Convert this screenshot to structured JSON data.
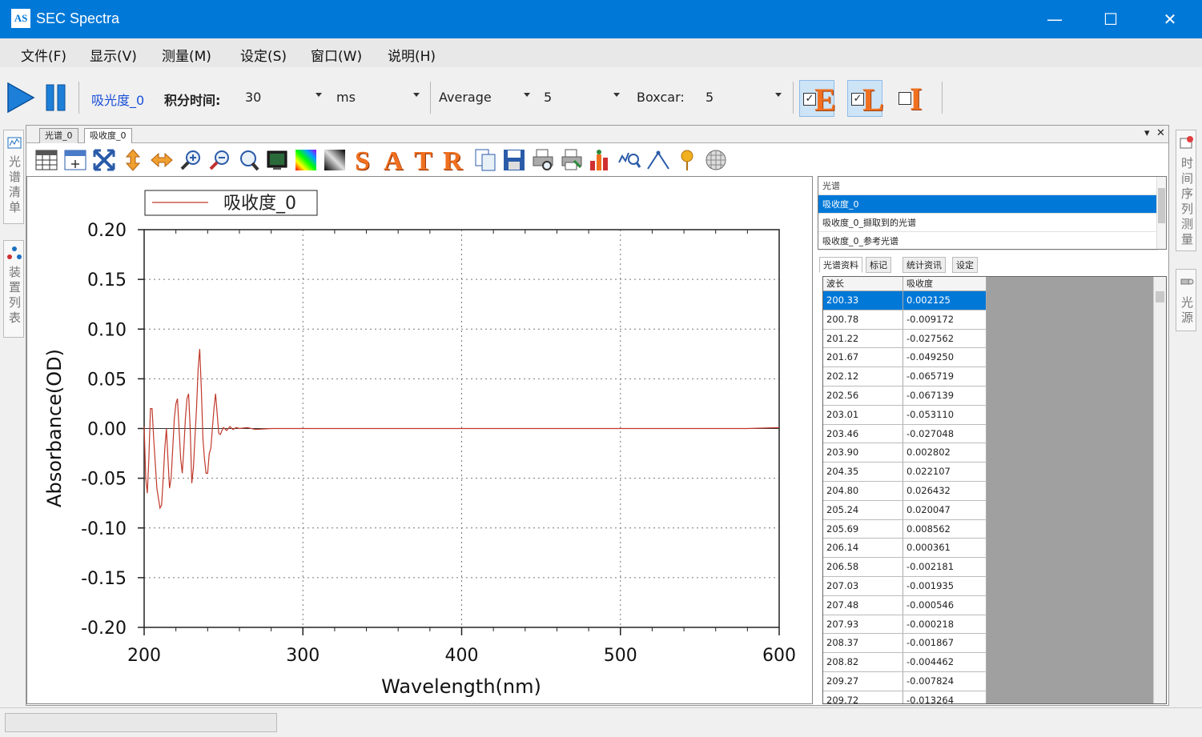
{
  "window": {
    "app_icon_text": "AS",
    "title": "SEC Spectra",
    "minimize": "—",
    "maximize": "☐",
    "close": "✕"
  },
  "menu": [
    "文件(F)",
    "显示(V)",
    "测量(M)",
    "设定(S)",
    "窗口(W)",
    "说明(H)"
  ],
  "toolbar": {
    "spectrum_name": "吸光度_0",
    "integration_label": "积分时间:",
    "integration_value": "30",
    "integration_unit": "ms",
    "average_label": "Average",
    "average_value": "5",
    "boxcar_label": "Boxcar:",
    "boxcar_value": "5",
    "eli": [
      {
        "letter": "E",
        "checked": true
      },
      {
        "letter": "L",
        "checked": true
      },
      {
        "letter": "I",
        "checked": false
      }
    ]
  },
  "left_dock": {
    "tab1": "光谱清单",
    "tab2": "装置列表"
  },
  "right_dock": {
    "tab1": "时间序列测量",
    "tab2": "光源"
  },
  "doc_tabs": {
    "tab1": "光谱_0",
    "tab2": "吸收度_0",
    "dropdown": "▾",
    "close": "✕"
  },
  "icon_letters": [
    "S",
    "A",
    "T",
    "R"
  ],
  "spectrum_list": {
    "header": "光谱",
    "items": [
      "吸收度_0",
      "吸收度_0_撷取到的光谱",
      "吸收度_0_参考光谱"
    ],
    "selected": 0
  },
  "sub_tabs": [
    "光谱资料",
    "标记",
    "统计资讯",
    "设定"
  ],
  "data_grid": {
    "columns": [
      "波长",
      "吸收度"
    ],
    "rows": [
      [
        "200.33",
        "0.002125"
      ],
      [
        "200.78",
        "-0.009172"
      ],
      [
        "201.22",
        "-0.027562"
      ],
      [
        "201.67",
        "-0.049250"
      ],
      [
        "202.12",
        "-0.065719"
      ],
      [
        "202.56",
        "-0.067139"
      ],
      [
        "203.01",
        "-0.053110"
      ],
      [
        "203.46",
        "-0.027048"
      ],
      [
        "203.90",
        "0.002802"
      ],
      [
        "204.35",
        "0.022107"
      ],
      [
        "204.80",
        "0.026432"
      ],
      [
        "205.24",
        "0.020047"
      ],
      [
        "205.69",
        "0.008562"
      ],
      [
        "206.14",
        "0.000361"
      ],
      [
        "206.58",
        "-0.002181"
      ],
      [
        "207.03",
        "-0.001935"
      ],
      [
        "207.48",
        "-0.000546"
      ],
      [
        "207.93",
        "-0.000218"
      ],
      [
        "208.37",
        "-0.001867"
      ],
      [
        "208.82",
        "-0.004462"
      ],
      [
        "209.27",
        "-0.007824"
      ],
      [
        "209.72",
        "-0.013264"
      ]
    ],
    "selected": 0
  },
  "chart_data": {
    "type": "line",
    "xlabel": "Wavelength(nm)",
    "ylabel": "Absorbance(OD)",
    "xlim": [
      200,
      600
    ],
    "ylim": [
      -0.2,
      0.2
    ],
    "xticks": [
      "200",
      "300",
      "400",
      "500",
      "600"
    ],
    "yticks": [
      "0.20",
      "0.15",
      "0.10",
      "0.05",
      "0.00",
      "-0.05",
      "-0.10",
      "-0.15",
      "-0.20"
    ],
    "grid": true,
    "legend_position": "top-left",
    "series": [
      {
        "name": "吸收度_0",
        "color": "#c0392b",
        "x": [
          200,
          201,
          202,
          203,
          204,
          205,
          206,
          207,
          208,
          209,
          210,
          211,
          212,
          213,
          214,
          215,
          216,
          217,
          218,
          219,
          220,
          221,
          222,
          223,
          224,
          225,
          226,
          227,
          228,
          229,
          230,
          231,
          232,
          233,
          234,
          235,
          236,
          237,
          238,
          239,
          240,
          241,
          242,
          243,
          244,
          245,
          246,
          247,
          248,
          249,
          250,
          252,
          254,
          256,
          258,
          260,
          265,
          270,
          280,
          290,
          300,
          320,
          340,
          360,
          380,
          400,
          420,
          440,
          460,
          480,
          500,
          520,
          540,
          560,
          580,
          600
        ],
        "y": [
          0.002,
          -0.05,
          -0.065,
          -0.03,
          0.02,
          0.02,
          -0.01,
          -0.035,
          -0.06,
          -0.07,
          -0.08,
          -0.077,
          -0.05,
          -0.02,
          0.0,
          -0.03,
          -0.06,
          -0.05,
          -0.02,
          0.01,
          0.025,
          0.03,
          0.0,
          -0.03,
          -0.045,
          -0.02,
          0.01,
          0.03,
          0.035,
          0.0,
          -0.055,
          -0.04,
          -0.01,
          0.02,
          0.06,
          0.08,
          0.04,
          -0.01,
          -0.03,
          -0.045,
          -0.045,
          -0.025,
          -0.02,
          0.0,
          0.02,
          0.035,
          0.015,
          -0.005,
          -0.006,
          -0.002,
          0.001,
          -0.002,
          0.002,
          -0.001,
          0.001,
          0.0,
          0.001,
          -0.001,
          0.0,
          0.0,
          0.0,
          0.0,
          0.0,
          0.0,
          0.0,
          0.0,
          0.0,
          0.0,
          0.0,
          0.0,
          0.0,
          0.0,
          0.0,
          0.0,
          0.0,
          0.001
        ]
      }
    ]
  }
}
